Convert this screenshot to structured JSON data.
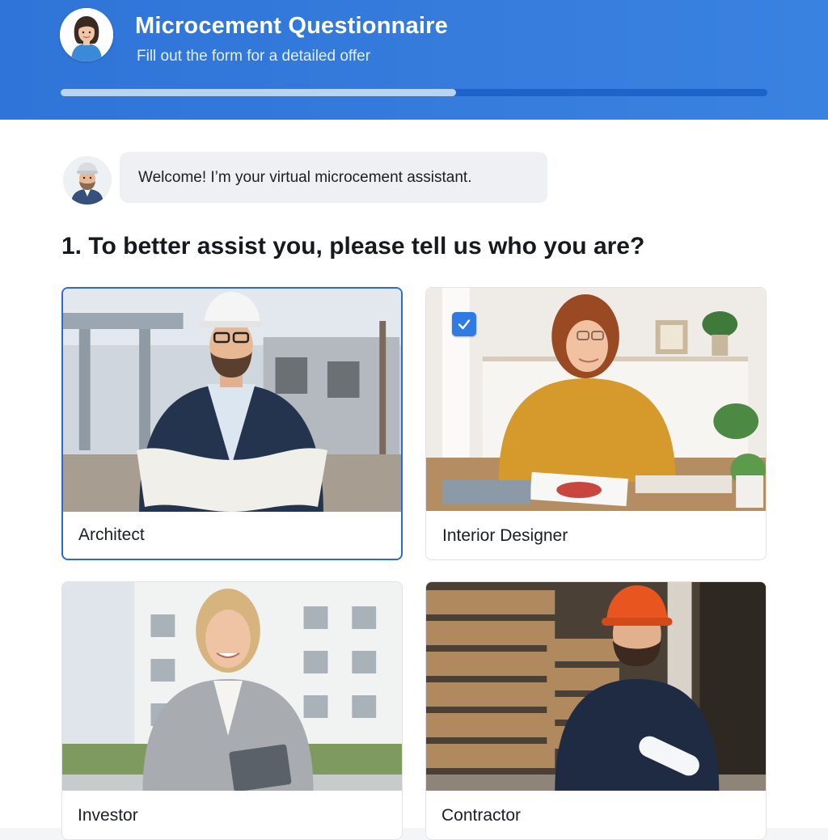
{
  "header": {
    "title": "Microcement Questionnaire",
    "subtitle": "Fill out the form for a detailed offer",
    "progress": 0.56,
    "avatar_icon": "woman-avatar-icon"
  },
  "chat": {
    "avatar_icon": "assistant-avatar-icon",
    "message": "Welcome! I’m your virtual microcement assistant."
  },
  "question": {
    "text": "1. To better assist you, please tell us who you are?",
    "options": [
      {
        "label": "Architect",
        "state": "focused"
      },
      {
        "label": "Interior Designer",
        "state": "checked"
      },
      {
        "label": "Investor",
        "state": "default"
      },
      {
        "label": "Contractor",
        "state": "default"
      }
    ]
  },
  "colors": {
    "header": "#2f74d8",
    "accent": "#2c6ad3",
    "progress_track": "#1e63c9",
    "progress_fill": "#b9d3f2",
    "checkbox": "#2f7be6"
  }
}
